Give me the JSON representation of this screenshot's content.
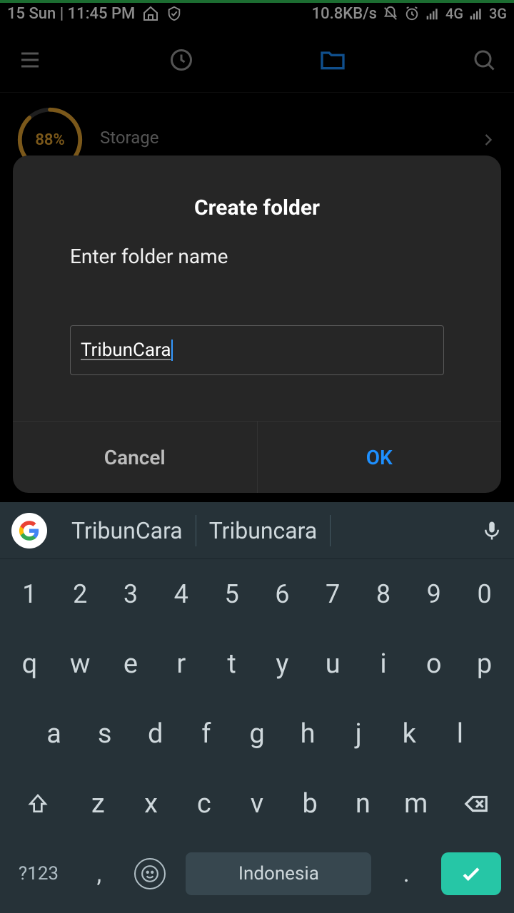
{
  "status": {
    "date_time": "15 Sun | 11:45 PM",
    "speed": "10.8KB/s",
    "net1": "4G",
    "net2": "3G"
  },
  "storage": {
    "label": "Storage",
    "percent": "88%",
    "ring_value": 88
  },
  "modal": {
    "title": "Create folder",
    "label": "Enter folder name",
    "value": "TribunCara",
    "cancel": "Cancel",
    "ok": "OK"
  },
  "keyboard": {
    "suggestion1": "TribunCara",
    "suggestion2": "Tribuncara",
    "row_nums": [
      "1",
      "2",
      "3",
      "4",
      "5",
      "6",
      "7",
      "8",
      "9",
      "0"
    ],
    "row1": [
      "q",
      "w",
      "e",
      "r",
      "t",
      "y",
      "u",
      "i",
      "o",
      "p"
    ],
    "row2": [
      "a",
      "s",
      "d",
      "f",
      "g",
      "h",
      "j",
      "k",
      "l"
    ],
    "row3": [
      "z",
      "x",
      "c",
      "v",
      "b",
      "n",
      "m"
    ],
    "symbols": "?123",
    "comma": ",",
    "period": ".",
    "space_label": "Indonesia"
  }
}
